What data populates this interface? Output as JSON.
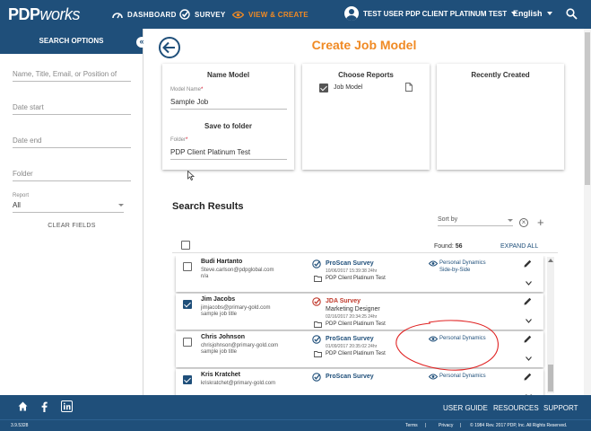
{
  "nav": {
    "logo_main": "PDP",
    "logo_works": "works",
    "items": [
      {
        "label": "DASHBOARD",
        "icon": "gauge-icon"
      },
      {
        "label": "SURVEY",
        "icon": "check-circle-icon"
      },
      {
        "label": "VIEW & CREATE",
        "icon": "eye-icon",
        "active": true
      }
    ],
    "user": "TEST USER PDP CLIENT PLATINUM TEST",
    "language": "English",
    "active_color": "#f08a24",
    "brand_color": "#1f4f7a"
  },
  "sidebar": {
    "title": "SEARCH OPTIONS",
    "collapse_glyph": "«",
    "fields": [
      {
        "placeholder": "Name, Title, Email, or Position of"
      },
      {
        "placeholder": "Date start"
      },
      {
        "placeholder": "Date end"
      },
      {
        "placeholder": "Folder"
      }
    ],
    "report_label": "Report",
    "report_value": "All",
    "clear_label": "CLEAR FIELDS"
  },
  "main": {
    "page_title": "Create Job Model",
    "name_card": {
      "title": "Name Model",
      "model_label": "Model Name",
      "model_value": "Sample Job",
      "save_title": "Save to folder",
      "folder_label": "Folder",
      "folder_value": "PDP Client Platinum Test",
      "required_mark": "*"
    },
    "reports_card": {
      "title": "Choose Reports",
      "item": "Job Model"
    },
    "recent_card": {
      "title": "Recently Created"
    },
    "results": {
      "title": "Search Results",
      "sort_label": "Sort by",
      "found_label": "Found:",
      "found_count": "56",
      "expand_all": "EXPAND ALL",
      "rows": [
        {
          "name": "Budi Hartanto",
          "email": "Steve.carlson@pdpglobal.com",
          "sub": "n/a",
          "checked": false,
          "survey": "ProScan Survey",
          "survey_type": "proscan",
          "extra": "",
          "date": "10/06/2017 15:39:38 24hr",
          "folder": "PDP Client Platinum Test",
          "report": "Personal Dynamics",
          "report2": "Side-by-Side"
        },
        {
          "name": "Jim Jacobs",
          "email": "jimjacobs@primary-gold.com",
          "sub": "sample job title",
          "checked": true,
          "survey": "JDA Survey",
          "survey_type": "jda",
          "extra": "Marketing Designer",
          "date": "02/16/2017 20:34:25 24hr",
          "folder": "PDP Client Platinum Test",
          "report": "",
          "report2": ""
        },
        {
          "name": "Chris Johnson",
          "email": "chrisjohnson@primary-gold.com",
          "sub": "sample job title",
          "checked": false,
          "survey": "ProScan Survey",
          "survey_type": "proscan",
          "extra": "",
          "date": "01/09/2017 20:35:02 24hr",
          "folder": "PDP Client Platinum Test",
          "report": "Personal Dynamics",
          "report2": ""
        },
        {
          "name": "Kris Kratchet",
          "email": "kriskratchet@primary-gold.com",
          "sub": "",
          "checked": true,
          "survey": "ProScan Survey",
          "survey_type": "proscan",
          "extra": "",
          "date": "",
          "folder": "",
          "report": "Personal Dynamics",
          "report2": ""
        }
      ]
    }
  },
  "footer": {
    "links": [
      "USER GUIDE",
      "RESOURCES",
      "SUPPORT"
    ],
    "icons": [
      "home-icon",
      "facebook-icon",
      "linkedin-icon"
    ],
    "version": "3.9.5328",
    "terms": "Terms",
    "privacy": "Privacy",
    "copyright": "© 1984 Rev. 2017 PDP, Inc. All Rights Reserved."
  }
}
